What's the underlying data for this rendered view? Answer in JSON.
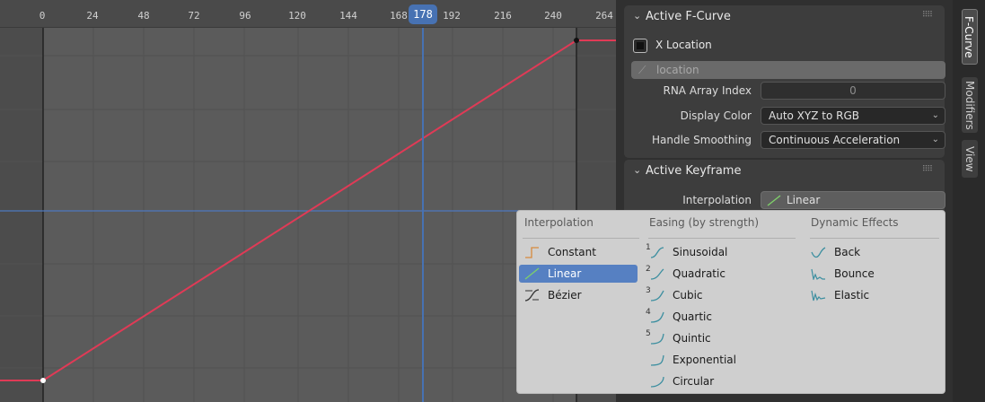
{
  "timeline": {
    "ticks": [
      "0",
      "24",
      "48",
      "72",
      "96",
      "120",
      "144",
      "168",
      "192",
      "216",
      "240",
      "264"
    ],
    "current_frame": "178"
  },
  "colors": {
    "curve": "#e03a56",
    "playhead": "#4772b3",
    "selection": "#5680c2",
    "menu_bg": "#cfcfcf"
  },
  "active_fcurve": {
    "title": "Active F-Curve",
    "channel_name": "X Location",
    "data_path": "location",
    "rna_index_label": "RNA Array Index",
    "rna_index_value": "0",
    "display_color_label": "Display Color",
    "display_color_value": "Auto XYZ to RGB",
    "handle_smoothing_label": "Handle Smoothing",
    "handle_smoothing_value": "Continuous Acceleration"
  },
  "active_keyframe": {
    "title": "Active Keyframe",
    "interpolation_label": "Interpolation",
    "interpolation_value": "Linear"
  },
  "tabs": [
    "F-Curve",
    "Modifiers",
    "View"
  ],
  "menu": {
    "interpolation_header": "Interpolation",
    "easing_header": "Easing (by strength)",
    "dynamic_header": "Dynamic Effects",
    "interpolation_items": [
      "Constant",
      "Linear",
      "Bézier"
    ],
    "easing_items": [
      "Sinusoidal",
      "Quadratic",
      "Cubic",
      "Quartic",
      "Quintic",
      "Exponential",
      "Circular"
    ],
    "easing_numbers": [
      "1",
      "2",
      "3",
      "4",
      "5"
    ],
    "dynamic_items": [
      "Back",
      "Bounce",
      "Elastic"
    ],
    "selected": "Linear"
  }
}
